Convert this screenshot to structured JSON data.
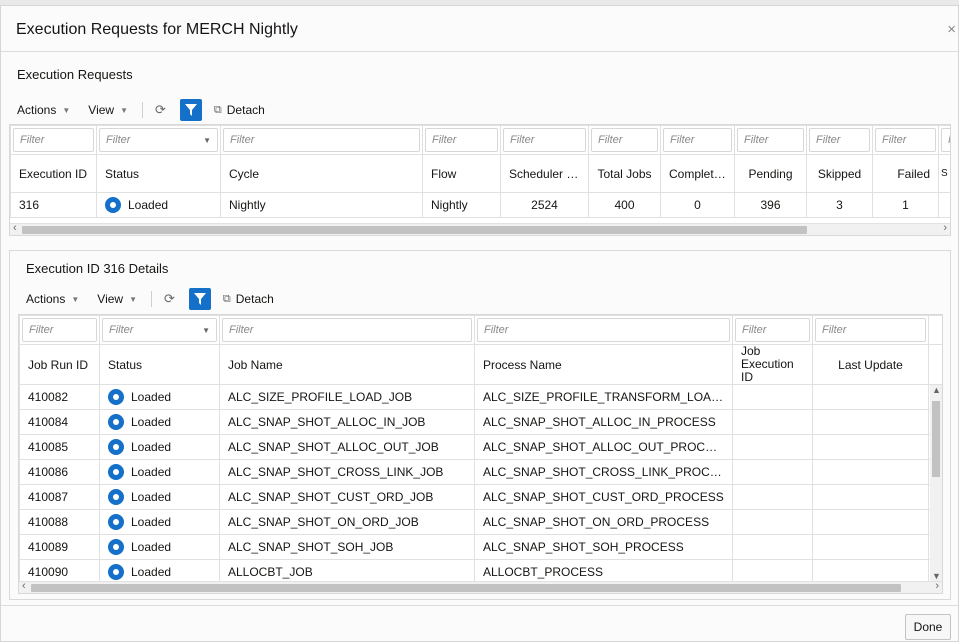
{
  "dialog": {
    "title": "Execution Requests for MERCH Nightly",
    "close_glyph": "×"
  },
  "toolbar": {
    "actions": "Actions",
    "view": "View",
    "detach": "Detach"
  },
  "requests": {
    "title": "Execution Requests",
    "filter_placeholder": "Filter",
    "columns": [
      "Execution ID",
      "Status",
      "Cycle",
      "Flow",
      "Scheduler Day",
      "Total Jobs",
      "Completed",
      "Pending",
      "Skipped",
      "Failed",
      "S H"
    ],
    "rows": [
      {
        "execution_id": "316",
        "status": "Loaded",
        "cycle": "Nightly",
        "flow": "Nightly",
        "scheduler_day": "2524",
        "total_jobs": "400",
        "completed": "0",
        "pending": "396",
        "skipped": "3",
        "failed": "1"
      }
    ]
  },
  "details": {
    "title": "Execution ID 316 Details",
    "filter_placeholder": "Filter",
    "columns": [
      "Job Run ID",
      "Status",
      "Job Name",
      "Process Name",
      "Job Execution ID",
      "Last Update"
    ],
    "rows": [
      {
        "job_run_id": "410082",
        "status": "Loaded",
        "job_name": "ALC_SIZE_PROFILE_LOAD_JOB",
        "process_name": "ALC_SIZE_PROFILE_TRANSFORM_LOAD_PROCE..."
      },
      {
        "job_run_id": "410084",
        "status": "Loaded",
        "job_name": "ALC_SNAP_SHOT_ALLOC_IN_JOB",
        "process_name": "ALC_SNAP_SHOT_ALLOC_IN_PROCESS"
      },
      {
        "job_run_id": "410085",
        "status": "Loaded",
        "job_name": "ALC_SNAP_SHOT_ALLOC_OUT_JOB",
        "process_name": "ALC_SNAP_SHOT_ALLOC_OUT_PROCESS"
      },
      {
        "job_run_id": "410086",
        "status": "Loaded",
        "job_name": "ALC_SNAP_SHOT_CROSS_LINK_JOB",
        "process_name": "ALC_SNAP_SHOT_CROSS_LINK_PROCESS"
      },
      {
        "job_run_id": "410087",
        "status": "Loaded",
        "job_name": "ALC_SNAP_SHOT_CUST_ORD_JOB",
        "process_name": "ALC_SNAP_SHOT_CUST_ORD_PROCESS"
      },
      {
        "job_run_id": "410088",
        "status": "Loaded",
        "job_name": "ALC_SNAP_SHOT_ON_ORD_JOB",
        "process_name": "ALC_SNAP_SHOT_ON_ORD_PROCESS"
      },
      {
        "job_run_id": "410089",
        "status": "Loaded",
        "job_name": "ALC_SNAP_SHOT_SOH_JOB",
        "process_name": "ALC_SNAP_SHOT_SOH_PROCESS"
      },
      {
        "job_run_id": "410090",
        "status": "Loaded",
        "job_name": "ALLOCBT_JOB",
        "process_name": "ALLOCBT_PROCESS"
      }
    ]
  },
  "footer": {
    "done": "Done"
  },
  "colors": {
    "accent": "#1570c9"
  }
}
